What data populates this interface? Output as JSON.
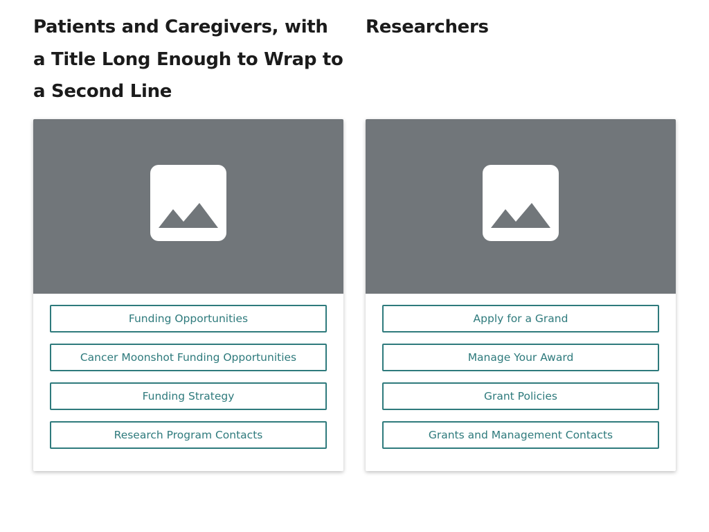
{
  "columns": [
    {
      "title": "Patients and Caregivers, with a Title Long Enough to Wrap to a Second Line",
      "image_icon": "image-placeholder-icon",
      "links": [
        "Funding Opportunities",
        "Cancer Moonshot Funding Opportunities",
        "Funding Strategy",
        "Research Program Contacts"
      ]
    },
    {
      "title": "Researchers",
      "image_icon": "image-placeholder-icon",
      "links": [
        "Apply for a Grand",
        "Manage Your Award",
        "Grant Policies",
        "Grants and Management Contacts"
      ]
    }
  ],
  "colors": {
    "accent": "#2e7a7c",
    "image_background": "#71767a",
    "heading_text": "#1b1b1b"
  }
}
